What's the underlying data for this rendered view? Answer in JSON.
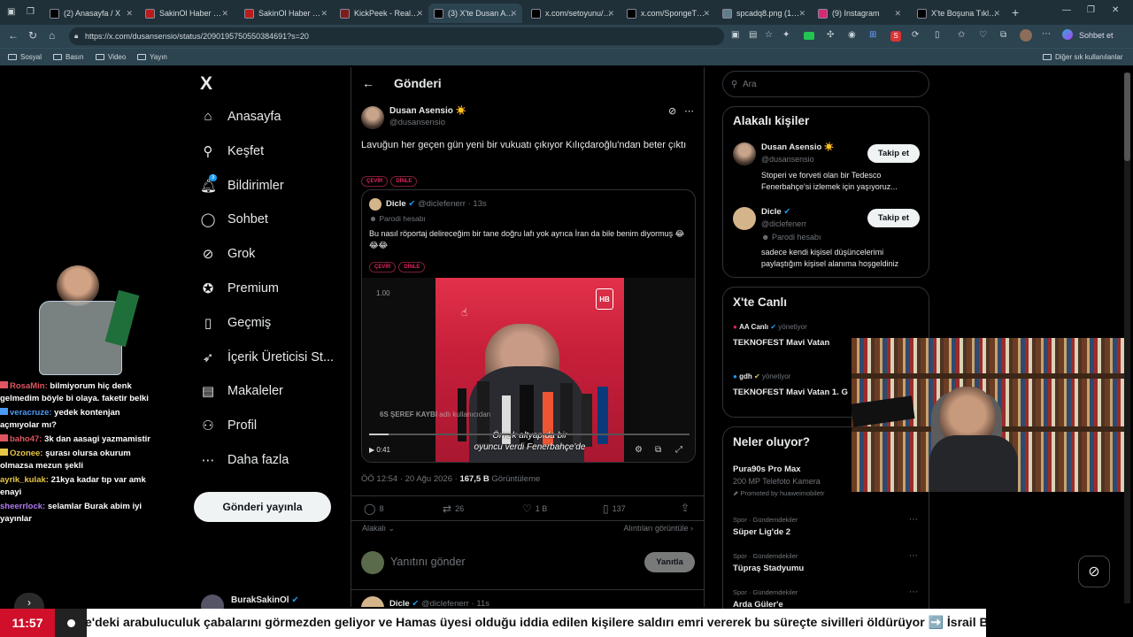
{
  "browser": {
    "tabs": [
      {
        "label": "(2) Anasayfa / X",
        "favicon_color": "#000000"
      },
      {
        "label": "SakinOl Haber Merk",
        "favicon_color": "#b91c1c"
      },
      {
        "label": "SakinOl Haber Merk",
        "favicon_color": "#b91c1c"
      },
      {
        "label": "KickPeek - Real-tim",
        "favicon_color": "#7f1d1d"
      },
      {
        "label": "(3) X'te Dusan Asen",
        "favicon_color": "#000000"
      },
      {
        "label": "x.com/setoyunu/sta",
        "favicon_color": "#000000"
      },
      {
        "label": "x.com/SpongeThrill",
        "favicon_color": "#000000"
      },
      {
        "label": "spcadq8.png (1536",
        "favicon_color": "#607d8b"
      },
      {
        "label": "(9) Instagram",
        "favicon_color": "#d62976"
      },
      {
        "label": "X'te Boşuna Tıklam",
        "favicon_color": "#000000"
      }
    ],
    "url": "https://x.com/dusansensio/status/2090195750550384691?s=20",
    "profile_label": "Sohbet et",
    "bookmarks": [
      "Sosyal",
      "Basın",
      "Video",
      "Yayın"
    ],
    "other_bookmarks": "Diğer sık kullanılanlar"
  },
  "nav": {
    "logo": "X",
    "items": [
      {
        "label": "Anasayfa",
        "icon": "home-icon",
        "glyph": "⌂"
      },
      {
        "label": "Keşfet",
        "icon": "search-icon",
        "glyph": "⚲"
      },
      {
        "label": "Bildirimler",
        "icon": "bell-icon",
        "glyph": "🔔︎",
        "badge": "3"
      },
      {
        "label": "Sohbet",
        "icon": "chat-icon",
        "glyph": "◯"
      },
      {
        "label": "Grok",
        "icon": "grok-icon",
        "glyph": "⊘"
      },
      {
        "label": "Premium",
        "icon": "premium-icon",
        "glyph": "✪"
      },
      {
        "label": "Geçmiş",
        "icon": "bookmark-icon",
        "glyph": "▯"
      },
      {
        "label": "İçerik Üreticisi St...",
        "icon": "rocket-icon",
        "glyph": "➶"
      },
      {
        "label": "Makaleler",
        "icon": "articles-icon",
        "glyph": "▤"
      },
      {
        "label": "Profil",
        "icon": "profile-icon",
        "glyph": "⚇"
      },
      {
        "label": "Daha fazla",
        "icon": "more-icon",
        "glyph": "⋯"
      }
    ],
    "post_button": "Gönderi yayınla",
    "account_name": "BurakSakinOl"
  },
  "main": {
    "header_title": "Gönderi",
    "post": {
      "author": "Dusan Asensio ☀️",
      "handle": "@dusansensio",
      "text": "Lavuğun her geçen gün yeni bir vukuatı çıkıyor Kılıçdaroğlu'ndan beter çıktı",
      "badges": [
        "ÇEVİR",
        "DİNLE"
      ],
      "timestamp": "ÖÖ 12:54 · 20 Ağu 2026 · ",
      "views": "167,5 B",
      "views_label": " Görüntüleme",
      "replies": "8",
      "reposts": "26",
      "likes": "1 B",
      "bookmarks": "137",
      "relevant": "Alakalı",
      "quotes_link": "Alıntıları görüntüle"
    },
    "quote": {
      "author": "Dicle",
      "handle": "@diclefenerr · 13s",
      "parody": "Parodi hesabı",
      "text": "Bu nasıl röportaj delireceğim bir tane doğru lafı yok ayrıca İran da  bile benim diyormuş 😂😂😂",
      "badges": [
        "ÇEVİR",
        "DİNLE"
      ],
      "video_speed": "1.00",
      "video_time": "0:41",
      "video_overlay_user": "6S ŞEREF KAYBI",
      "video_overlay_sub": "adlı kullanıcıdan",
      "subtitle_line1": "Örnek altyapıda bir",
      "subtitle_line2": "oyuncu verdi Fenerbahçe'de"
    },
    "reply_placeholder": "Yanıtını gönder",
    "reply_button": "Yanıtla",
    "next_author": "Dicle",
    "next_handle": "@diclefenerr · 11s"
  },
  "right": {
    "search_placeholder": "Ara",
    "who_title": "Alakalı kişiler",
    "people": [
      {
        "name": "Dusan Asensio ☀️",
        "handle": "@dusansensio",
        "bio": "Stoperi ve forveti olan bir Tedesco Fenerbahçe'si izlemek için yaşıyoruz...",
        "button": "Takip et"
      },
      {
        "name": "Dicle",
        "handle": "@diclefenerr",
        "parody": "Parodi hesabı",
        "bio": "sadece kendi kişisel düşüncelerimi paylaştığım kişisel alanıma hoşgeldiniz",
        "button": "Takip et"
      }
    ],
    "live_title": "X'te Canlı",
    "live": [
      {
        "host": "AA Canlı",
        "role": "yönetiyor",
        "title": "TEKNOFEST Mavi Vatan"
      },
      {
        "host": "gdh",
        "role": "yönetiyor",
        "title": "TEKNOFEST Mavi Vatan 1. G"
      }
    ],
    "trends_title": "Neler oluyor?",
    "ad": {
      "title": "Pura90s Pro Max",
      "sub": "200 MP Telefoto Kamera",
      "promo": "Promoted by huaweimobiletr"
    },
    "trends": [
      {
        "context": "Spor · Gündemdekiler",
        "name": "Süper Lig'de 2"
      },
      {
        "context": "Spor · Gündemdekiler",
        "name": "Tüpraş Stadyumu"
      },
      {
        "context": "Spor · Gündemdekiler",
        "name": "Arda Güler'e"
      }
    ]
  },
  "chat": [
    {
      "user": "RosaMin:",
      "color": "#e05561",
      "msg": "bilmiyorum hiç denk gelmedim böyle bi olaya. faketir belki"
    },
    {
      "user": "veracruze:",
      "color": "#4a9cf5",
      "msg": "yedek kontenjan açmıyolar mı?"
    },
    {
      "user": "baho47:",
      "color": "#e05561",
      "msg": "3k dan aasagi yazmamistir"
    },
    {
      "user": "Ozonee:",
      "color": "#e8c547",
      "msg": "şurası olursa okurum olmazsa mezun şekli"
    },
    {
      "user": "ayrik_kulak:",
      "color": "#e8c547",
      "msg": "21kya kadar tıp var amk enayi"
    },
    {
      "user": "sheerrlock:",
      "color": "#b07cf0",
      "msg": "selamlar Burak abim iyi yayınlar"
    }
  ],
  "ticker": {
    "time": "11:57",
    "text": "e'deki arabuluculuk çabalarını görmezden geliyor ve Hamas üyesi olduğu iddia edilen kişilere saldırı emri vererek bu süreçte sivilleri öldürüyor ➡️ İsrail Başba"
  }
}
